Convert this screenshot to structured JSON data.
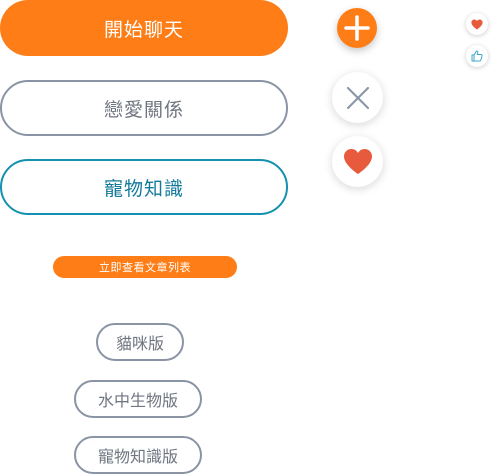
{
  "colors": {
    "orange": "#fe7d16",
    "gray": "#8a94a4",
    "gray_text": "#6f7680",
    "teal": "#1590b0",
    "teal_text": "#127a9b",
    "heart_red": "#e75a3c",
    "thumb_blue": "#3aa8c8",
    "white": "#ffffff"
  },
  "buttons": {
    "start_chat": "開始聊天",
    "relationship": "戀愛關係",
    "pet_knowledge": "寵物知識",
    "view_articles": "立即查看文章列表"
  },
  "boards": [
    "貓咪版",
    "水中生物版",
    "寵物知識版"
  ],
  "icons": {
    "add": "plus-icon",
    "close": "close-icon",
    "favorite": "heart-icon",
    "mini_favorite": "heart-icon",
    "mini_like": "thumbs-up-icon"
  }
}
